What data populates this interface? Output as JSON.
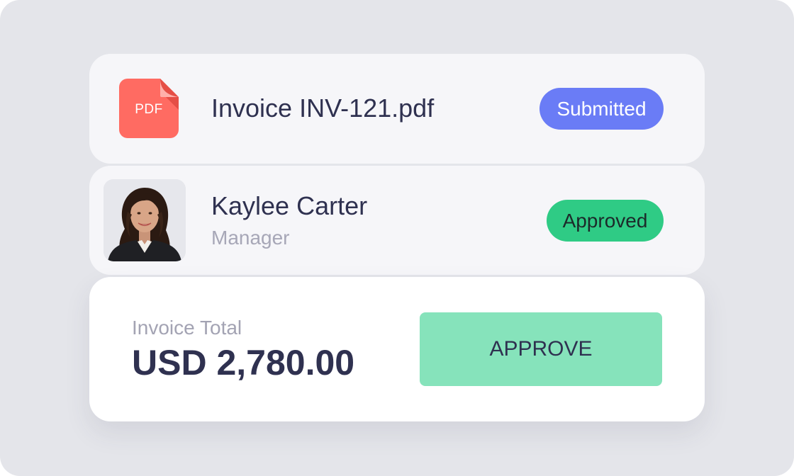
{
  "file_card": {
    "icon_label": "PDF",
    "file_name": "Invoice INV-121.pdf",
    "status": "Submitted",
    "status_color": "#6a7cf6",
    "icon_color": "#ff6b62"
  },
  "person_card": {
    "name": "Kaylee Carter",
    "role": "Manager",
    "status": "Approved",
    "status_color": "#2fcb85"
  },
  "total_card": {
    "label": "Invoice Total",
    "amount": "USD 2,780.00",
    "action_label": "APPROVE",
    "action_color": "#86e3bb"
  },
  "icons": {
    "file_icon": "pdf-file-icon",
    "avatar": "person-photo"
  }
}
